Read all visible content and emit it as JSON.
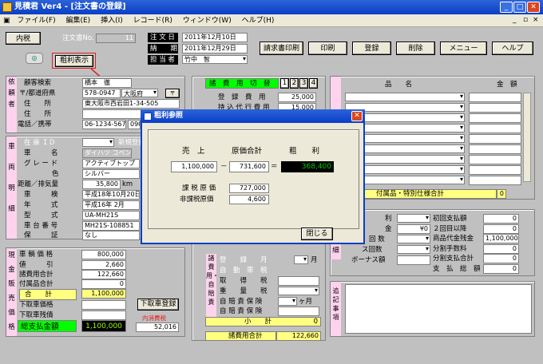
{
  "window": {
    "title": "見積君 Ver4 - [注文書の登録]"
  },
  "menu": [
    "ファイル(F)",
    "編集(E)",
    "挿入(I)",
    "レコード(R)",
    "ウィンドウ(W)",
    "ヘルプ(H)"
  ],
  "header": {
    "btn_naizei": "内税",
    "order_no_label": "注文書No.",
    "order_no_value": "11",
    "order_date_label": "注 文 日",
    "order_date_value": "2011年12月10日",
    "delivery_label": "納　　期",
    "delivery_value": "2011年12月29日",
    "staff_label": "担 当 者",
    "staff_value": "竹中　智",
    "btn_profit": "粗利表示",
    "buttons": [
      "請求書印刷",
      "印刷",
      "登録",
      "削除",
      "メニュー",
      "ヘルプ"
    ]
  },
  "customer": {
    "side": "依頼者",
    "search_label": "顧客検索",
    "search_value": "橋本　徹",
    "zip_label": "〒/都道府県",
    "zip_value": "578-0947",
    "pref_value": "大阪府",
    "addr_label": "住　　所",
    "addr_value": "東大阪市西岩田1-34-505",
    "addr2_label": "住　　所",
    "addr2_value": "",
    "side2": "所",
    "tel_label": "電話／携帯",
    "tel_value": "06-1234-5678",
    "tel2_value": "090"
  },
  "vehicle": {
    "side": "車両明細",
    "stock_label": "在 庫 ＩＤ",
    "stock_value": "",
    "btn_new": "新規登録",
    "name_label": "車　　　名",
    "name_value": "ダイハツ コペン",
    "grade_label": "グ レ ー ド",
    "grade_value": "アクティブトップ",
    "color_label": "色",
    "color_value": "シルバー",
    "dist_label": "距離／排気量",
    "dist_value": "35,800",
    "dist_unit": "km",
    "inspect_label": "車　　　検",
    "inspect_value": "平成18年10月20日",
    "year_label": "年　　　式",
    "year_value": "平成16年 2月",
    "type_label": "型　　　式",
    "type_value": "UA-MH21S",
    "chassis_label": "車 台 番 号",
    "chassis_value": "MH21S-108851",
    "warranty_label": "保　　　証",
    "warranty_value": "なし"
  },
  "sales": {
    "side": "現金販売価格",
    "price_label": "車 輌 価 格",
    "price_value": "800,000",
    "discount_label": "値　　　引",
    "discount_value": "2,660",
    "fees_label": "諸費用合計",
    "fees_value": "122,660",
    "parts_label": "付属品合計",
    "parts_value": "0",
    "total_label": "合　　計",
    "total_value": "1,100,000",
    "tradein_label": "下取車価格",
    "tradein_value": "",
    "tradein_rem_label": "下取車残債",
    "tradein_rem_value": "",
    "grand_label": "総支払金額",
    "grand_value": "1,100,000",
    "btn_tradein": "下取車登録",
    "tax_label": "内消費税",
    "tax_value": "52,016"
  },
  "fees": {
    "tab_label": "諸　費　用　切　替",
    "tabs": [
      "1",
      "2",
      "3",
      "4"
    ],
    "reg_label": "登　録　費　用",
    "reg_value": "25,000",
    "agent_label": "持 込 代 行 費 用",
    "agent_value": "15,000",
    "side2": "諸費用・自賠責",
    "rows": [
      "登　　録　　月",
      "自　動　車　税",
      "取　　得　　税",
      "重　　量　　税",
      "自 賠 責 保 険",
      "自 賠 責 保 険"
    ],
    "month_unit": "月",
    "kagetsu": "ヶ月",
    "subtotal_label": "小　　計",
    "subtotal_value": "0",
    "total_label": "諸費用合計",
    "total_value": "122,660"
  },
  "parts": {
    "side": "付",
    "head_name": "品　　名",
    "head_price": "金　額",
    "total_label": "付属品・特別仕様合計",
    "total_value": "0"
  },
  "payment": {
    "left_labels": [
      "利",
      "金",
      "回 数",
      "ス回数",
      "ボーナス額"
    ],
    "down_value": "¥0",
    "right_labels": [
      "初回支払額",
      "２回目以降",
      "商品代金残金",
      "分割手数料",
      "分割支払合計",
      "支　払　総　額"
    ],
    "right_values": [
      "0",
      "0",
      "1,100,000",
      "0",
      "0",
      "0"
    ],
    "side": "細"
  },
  "remarks": {
    "side": "追記事項",
    "value": ""
  },
  "dialog": {
    "title": "粗利参照",
    "sales_label": "売　上",
    "cost_label": "原価合計",
    "profit_label": "粗　　利",
    "sales_value": "1,100,000",
    "cost_value": "731,600",
    "profit_value": "368,400",
    "minus": "－",
    "equals": "＝",
    "taxed_label": "課 税 原 価",
    "taxed_value": "727,000",
    "untaxed_label": "非課税原価",
    "untaxed_value": "4,600",
    "close_btn": "閉じる"
  },
  "colors": {
    "accent": "#0a3ec7",
    "highlight": "#ffff80",
    "pink": "#ffd3ee",
    "profit": "#009900",
    "arrow": "#e02020"
  }
}
